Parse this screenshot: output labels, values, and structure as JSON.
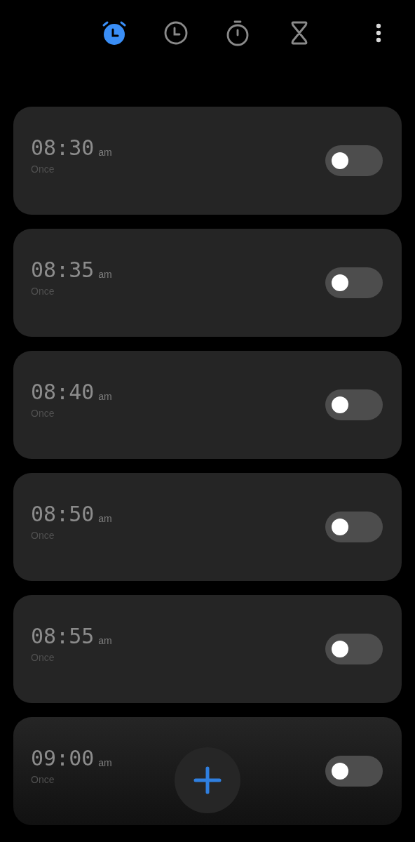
{
  "tabs": [
    {
      "kind": "alarm",
      "selected": true
    },
    {
      "kind": "world-clock",
      "selected": false
    },
    {
      "kind": "stopwatch",
      "selected": false
    },
    {
      "kind": "timer",
      "selected": false
    }
  ],
  "alarms": [
    {
      "time": "08:30",
      "period": "am",
      "repeat": "Once",
      "on": false
    },
    {
      "time": "08:35",
      "period": "am",
      "repeat": "Once",
      "on": false
    },
    {
      "time": "08:40",
      "period": "am",
      "repeat": "Once",
      "on": false
    },
    {
      "time": "08:50",
      "period": "am",
      "repeat": "Once",
      "on": false
    },
    {
      "time": "08:55",
      "period": "am",
      "repeat": "Once",
      "on": false
    },
    {
      "time": "09:00",
      "period": "am",
      "repeat": "Once",
      "on": false
    }
  ]
}
